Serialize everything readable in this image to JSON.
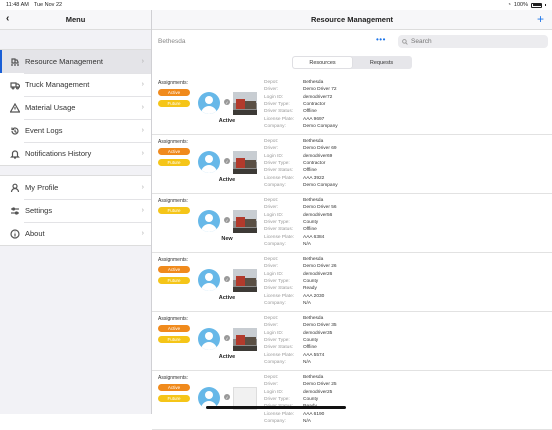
{
  "status_bar": {
    "time": "11:48 AM",
    "date": "Tue Nov 22",
    "battery": "100%"
  },
  "sidebar": {
    "title": "Menu",
    "items": [
      {
        "label": "Resource Management",
        "icon": "truck-route-icon",
        "active": true
      },
      {
        "label": "Truck Management",
        "icon": "truck-icon"
      },
      {
        "label": "Material Usage",
        "icon": "warning-triangle-icon"
      },
      {
        "label": "Event Logs",
        "icon": "history-icon"
      },
      {
        "label": "Notifications History",
        "icon": "bell-icon"
      }
    ],
    "items2": [
      {
        "label": "My Profile",
        "icon": "user-icon"
      },
      {
        "label": "Settings",
        "icon": "sliders-icon"
      },
      {
        "label": "About",
        "icon": "info-icon"
      }
    ]
  },
  "main": {
    "title": "Resource Management",
    "location": "Bethesda",
    "search_placeholder": "Search",
    "tabs": [
      "Resources",
      "Requests"
    ],
    "labels": {
      "assignments": "Assignments:",
      "depot": "Depot:",
      "driver": "Driver:",
      "login": "Login ID:",
      "type": "Driver Type:",
      "status": "Driver Status:",
      "plate": "License Plate:",
      "company": "Company:"
    },
    "cards": [
      {
        "pills": [
          "Active",
          "Future"
        ],
        "status": "Active",
        "photo": true,
        "depot": "Bethesda",
        "driver": "Demo Driver 72",
        "login": "demodriver72",
        "type": "Contractor",
        "driver_status": "Offline",
        "plate": "AAA 9697",
        "company": "Demo Company"
      },
      {
        "pills": [
          "Active",
          "Future"
        ],
        "status": "Active",
        "photo": true,
        "depot": "Bethesda",
        "driver": "Demo Driver 69",
        "login": "demodriver69",
        "type": "Contractor",
        "driver_status": "Offline",
        "plate": "AAA 3922",
        "company": "Demo Company"
      },
      {
        "pills": [
          "Future"
        ],
        "status": "New",
        "photo": true,
        "depot": "Bethesda",
        "driver": "Demo Driver 56",
        "login": "demodriver56",
        "type": "County",
        "driver_status": "Offline",
        "plate": "AAA 6384",
        "company": "N/A"
      },
      {
        "pills": [
          "Active",
          "Future"
        ],
        "status": "Active",
        "photo": true,
        "depot": "Bethesda",
        "driver": "Demo Driver 26",
        "login": "demodriver26",
        "type": "County",
        "driver_status": "Ready",
        "plate": "AAA 2030",
        "company": "N/A"
      },
      {
        "pills": [
          "Active",
          "Future"
        ],
        "status": "Active",
        "photo": true,
        "depot": "Bethesda",
        "driver": "Demo Driver 35",
        "login": "demodriver35",
        "type": "County",
        "driver_status": "Offline",
        "plate": "AAA 5574",
        "company": "N/A"
      },
      {
        "pills": [
          "Active",
          "Future"
        ],
        "status": "",
        "photo": false,
        "depot": "Bethesda",
        "driver": "Demo Driver 25",
        "login": "demodriver25",
        "type": "County",
        "driver_status": "Ready",
        "plate": "AAA 6190",
        "company": "N/A"
      }
    ]
  }
}
